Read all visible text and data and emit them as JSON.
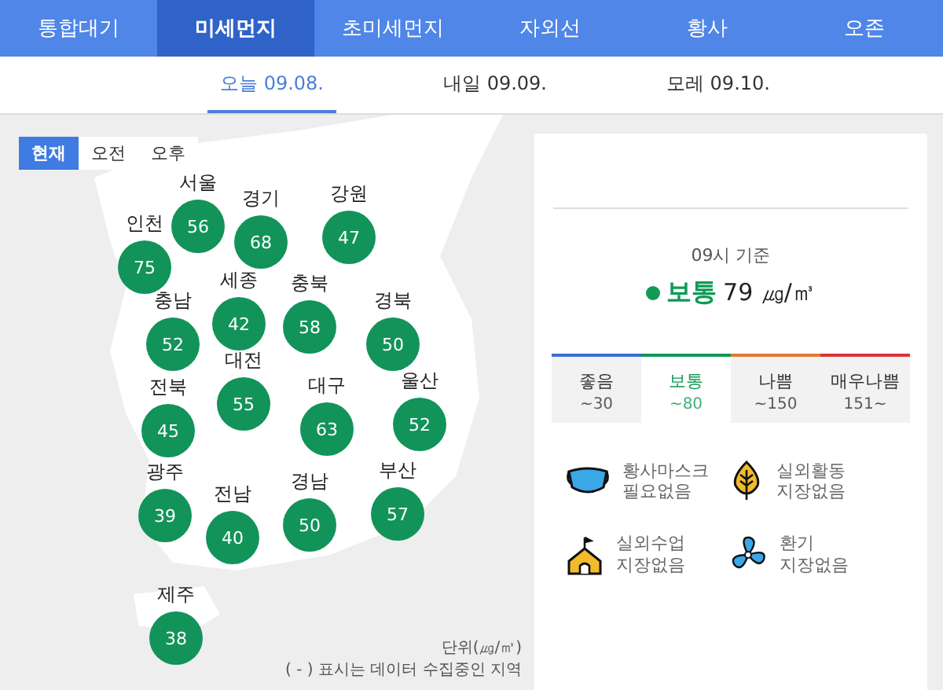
{
  "nav_tabs": [
    {
      "label": "통합대기",
      "selected": false
    },
    {
      "label": "미세먼지",
      "selected": true
    },
    {
      "label": "초미세먼지",
      "selected": false
    },
    {
      "label": "자외선",
      "selected": false
    },
    {
      "label": "황사",
      "selected": false
    },
    {
      "label": "오존",
      "selected": false
    }
  ],
  "date_tabs": [
    {
      "label": "오늘 09.08.",
      "selected": true
    },
    {
      "label": "내일 09.09.",
      "selected": false
    },
    {
      "label": "모레 09.10.",
      "selected": false
    }
  ],
  "time_toggle": [
    {
      "label": "현재",
      "selected": true
    },
    {
      "label": "오전",
      "selected": false
    },
    {
      "label": "오후",
      "selected": false
    }
  ],
  "regions": [
    {
      "name": "인천",
      "value": "75"
    },
    {
      "name": "서울",
      "value": "56"
    },
    {
      "name": "경기",
      "value": "68"
    },
    {
      "name": "강원",
      "value": "47"
    },
    {
      "name": "충남",
      "value": "52"
    },
    {
      "name": "세종",
      "value": "42"
    },
    {
      "name": "충북",
      "value": "58"
    },
    {
      "name": "경북",
      "value": "50"
    },
    {
      "name": "전북",
      "value": "45"
    },
    {
      "name": "대전",
      "value": "55"
    },
    {
      "name": "대구",
      "value": "63"
    },
    {
      "name": "울산",
      "value": "52"
    },
    {
      "name": "광주",
      "value": "39"
    },
    {
      "name": "전남",
      "value": "40"
    },
    {
      "name": "경남",
      "value": "50"
    },
    {
      "name": "부산",
      "value": "57"
    },
    {
      "name": "제주",
      "value": "38"
    }
  ],
  "unit_note": "단위(㎍/㎥)",
  "missing_note": "( - ) 표시는 데이터 수집중인 지역",
  "summary": {
    "time": "09시 기준",
    "grade": "보통",
    "value": "79 ㎍/㎥",
    "color": "#109a56"
  },
  "grades": [
    {
      "label": "좋음",
      "range": "~30",
      "color": "#3a6fd0",
      "selected": false
    },
    {
      "label": "보통",
      "range": "~80",
      "color": "#109a56",
      "selected": true
    },
    {
      "label": "나쁨",
      "range": "~150",
      "color": "#e07a2e",
      "selected": false
    },
    {
      "label": "매우나쁨",
      "range": "151~",
      "color": "#d8343a",
      "selected": false
    }
  ],
  "advice": [
    {
      "kind": "mask",
      "text": "황사마스크\n필요없음"
    },
    {
      "kind": "outdoor",
      "text": "실외활동\n지장없음"
    },
    {
      "kind": "school",
      "text": "실외수업\n지장없음"
    },
    {
      "kind": "fan",
      "text": "환기\n지장없음"
    }
  ]
}
